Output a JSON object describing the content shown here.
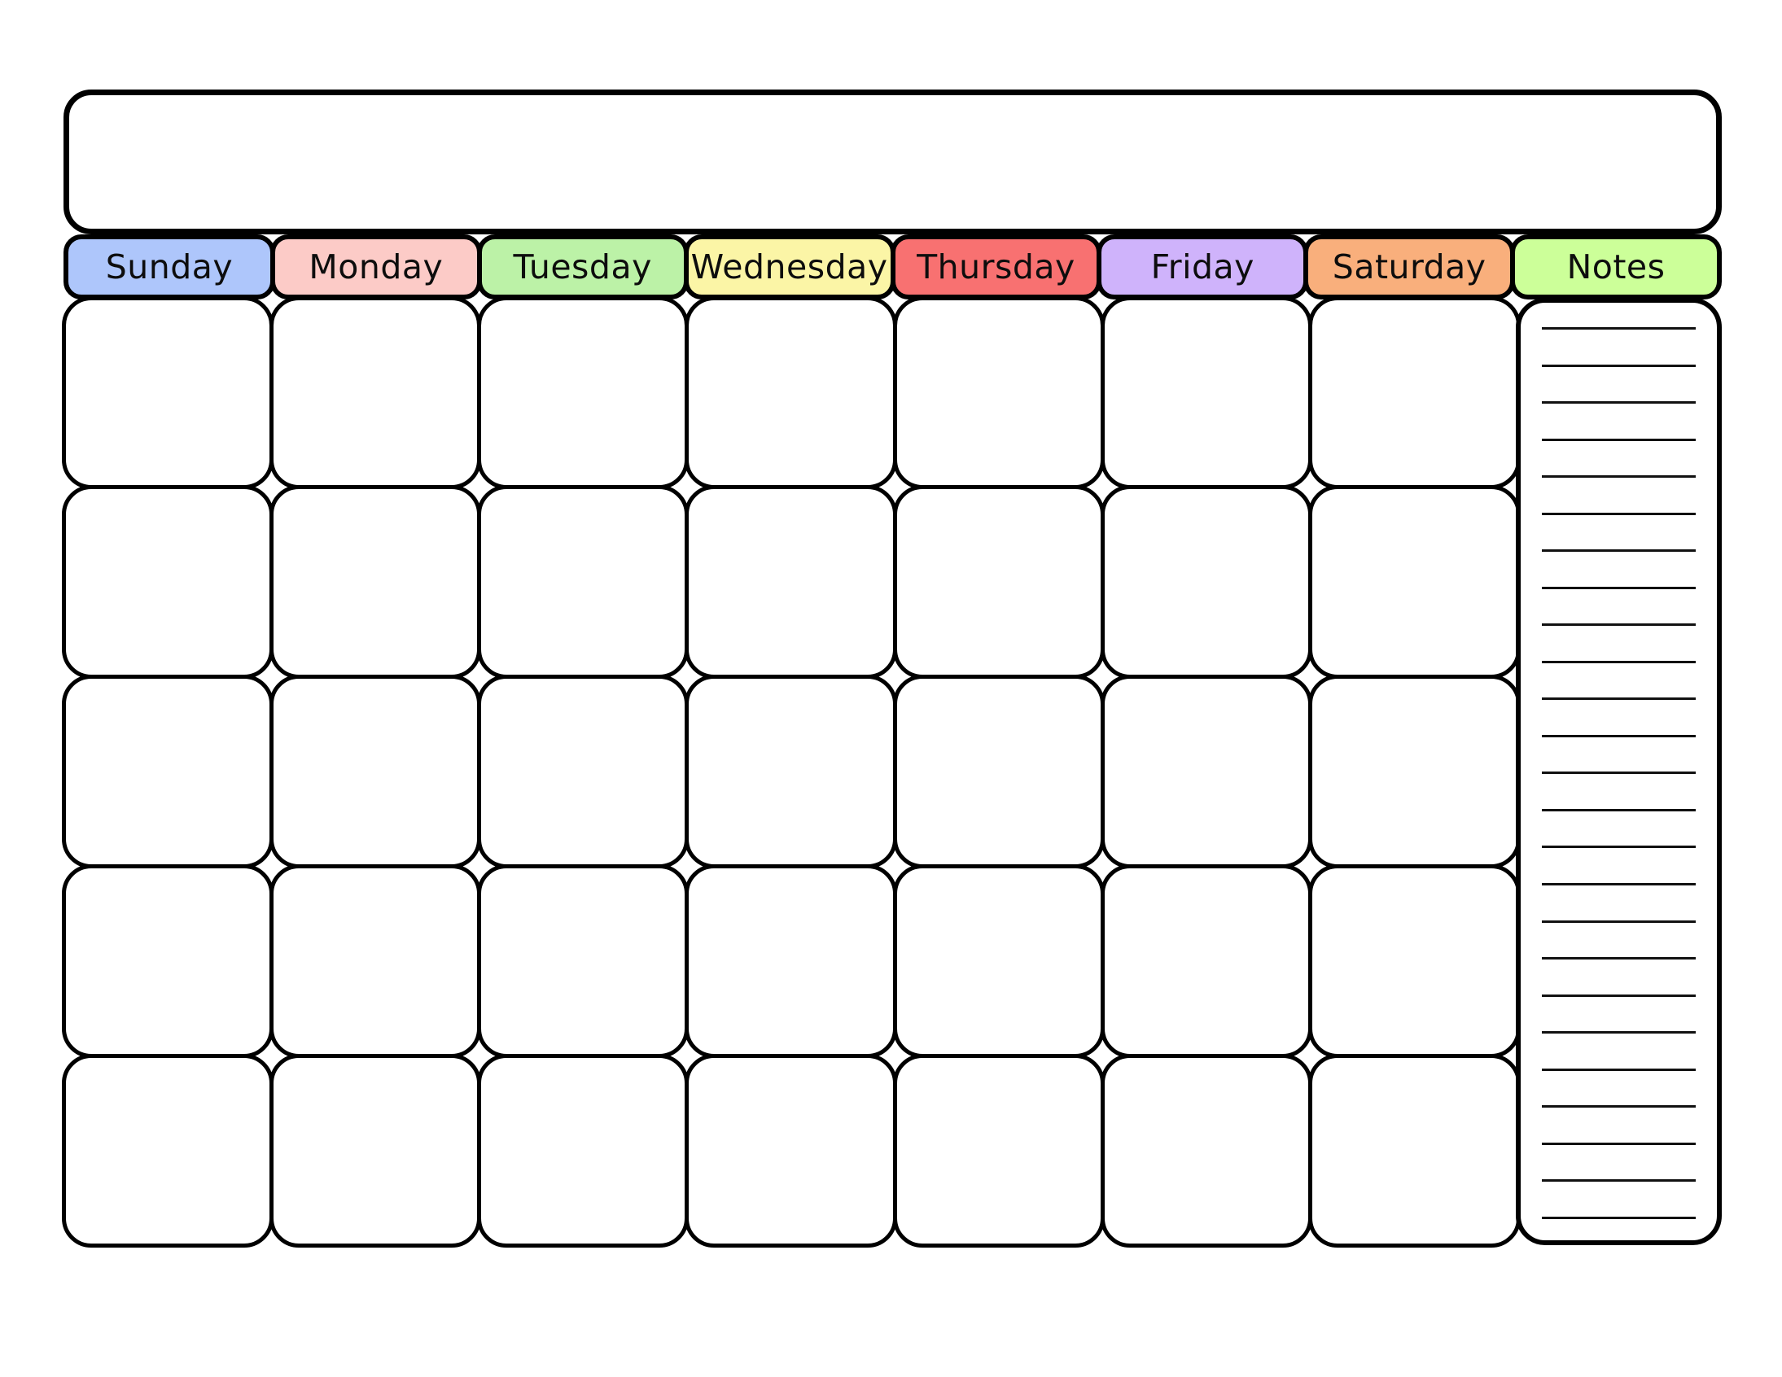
{
  "page": {
    "kind": "blank-monthly-calendar-template",
    "title_value": "",
    "title_placeholder": ""
  },
  "weekday_header": {
    "columns": [
      {
        "label": "Sunday",
        "color": "#AEC6FB"
      },
      {
        "label": "Monday",
        "color": "#FCCBC7"
      },
      {
        "label": "Tuesday",
        "color": "#BCF2A7"
      },
      {
        "label": "Wednesday",
        "color": "#FBF5A6"
      },
      {
        "label": "Thursday",
        "color": "#F87171"
      },
      {
        "label": "Friday",
        "color": "#CFB3FB"
      },
      {
        "label": "Saturday",
        "color": "#F9AF7C"
      },
      {
        "label": "Notes",
        "color": "#CCFF99"
      }
    ]
  },
  "grid": {
    "rows": 5,
    "cols": 7,
    "cells": [
      {
        "date": "",
        "note": ""
      },
      {
        "date": "",
        "note": ""
      },
      {
        "date": "",
        "note": ""
      },
      {
        "date": "",
        "note": ""
      },
      {
        "date": "",
        "note": ""
      },
      {
        "date": "",
        "note": ""
      },
      {
        "date": "",
        "note": ""
      },
      {
        "date": "",
        "note": ""
      },
      {
        "date": "",
        "note": ""
      },
      {
        "date": "",
        "note": ""
      },
      {
        "date": "",
        "note": ""
      },
      {
        "date": "",
        "note": ""
      },
      {
        "date": "",
        "note": ""
      },
      {
        "date": "",
        "note": ""
      },
      {
        "date": "",
        "note": ""
      },
      {
        "date": "",
        "note": ""
      },
      {
        "date": "",
        "note": ""
      },
      {
        "date": "",
        "note": ""
      },
      {
        "date": "",
        "note": ""
      },
      {
        "date": "",
        "note": ""
      },
      {
        "date": "",
        "note": ""
      },
      {
        "date": "",
        "note": ""
      },
      {
        "date": "",
        "note": ""
      },
      {
        "date": "",
        "note": ""
      },
      {
        "date": "",
        "note": ""
      },
      {
        "date": "",
        "note": ""
      },
      {
        "date": "",
        "note": ""
      },
      {
        "date": "",
        "note": ""
      },
      {
        "date": "",
        "note": ""
      },
      {
        "date": "",
        "note": ""
      },
      {
        "date": "",
        "note": ""
      },
      {
        "date": "",
        "note": ""
      },
      {
        "date": "",
        "note": ""
      },
      {
        "date": "",
        "note": ""
      },
      {
        "date": "",
        "note": ""
      }
    ]
  },
  "notes": {
    "line_count": 25,
    "lines": [
      "",
      "",
      "",
      "",
      "",
      "",
      "",
      "",
      "",
      "",
      "",
      "",
      "",
      "",
      "",
      "",
      "",
      "",
      "",
      "",
      "",
      "",
      "",
      "",
      ""
    ]
  },
  "colors": {
    "ink": "#000000",
    "paper": "#FFFFFF",
    "rule": "#111111"
  }
}
